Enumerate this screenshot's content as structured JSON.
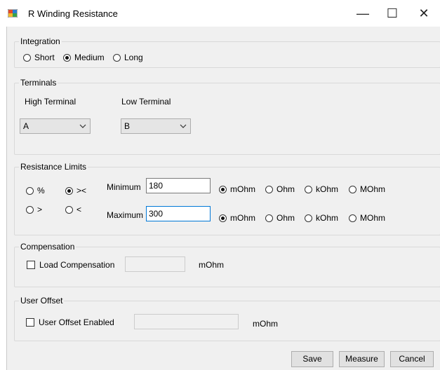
{
  "window": {
    "title": "R Winding Resistance",
    "minimize_glyph": "—",
    "maximize_glyph": "☐",
    "close_glyph": "✕",
    "icon": "app-icon"
  },
  "integration": {
    "legend": "Integration",
    "options": [
      {
        "label": "Short",
        "selected": false
      },
      {
        "label": "Medium",
        "selected": true
      },
      {
        "label": "Long",
        "selected": false
      }
    ]
  },
  "terminals": {
    "legend": "Terminals",
    "high_label": "High Terminal",
    "high_value": "A",
    "low_label": "Low Terminal",
    "low_value": "B"
  },
  "limits": {
    "legend": "Resistance Limits",
    "modes": [
      {
        "label": "%",
        "selected": false
      },
      {
        "label": "><",
        "selected": true
      },
      {
        "label": ">",
        "selected": false
      },
      {
        "label": "<",
        "selected": false
      }
    ],
    "minimum_label": "Minimum",
    "minimum_value": "180",
    "maximum_label": "Maximum",
    "maximum_value": "300",
    "min_units": [
      {
        "label": "mOhm",
        "selected": true
      },
      {
        "label": "Ohm",
        "selected": false
      },
      {
        "label": "kOhm",
        "selected": false
      },
      {
        "label": "MOhm",
        "selected": false
      }
    ],
    "max_units": [
      {
        "label": "mOhm",
        "selected": true
      },
      {
        "label": "Ohm",
        "selected": false
      },
      {
        "label": "kOhm",
        "selected": false
      },
      {
        "label": "MOhm",
        "selected": false
      }
    ]
  },
  "compensation": {
    "legend": "Compensation",
    "checkbox_label": "Load Compensation",
    "checked": false,
    "value": "",
    "unit": "mOhm"
  },
  "offset": {
    "legend": "User Offset",
    "checkbox_label": "User Offset Enabled",
    "checked": false,
    "value": "",
    "unit": "mOhm"
  },
  "buttons": {
    "save": "Save",
    "measure": "Measure",
    "cancel": "Cancel"
  }
}
